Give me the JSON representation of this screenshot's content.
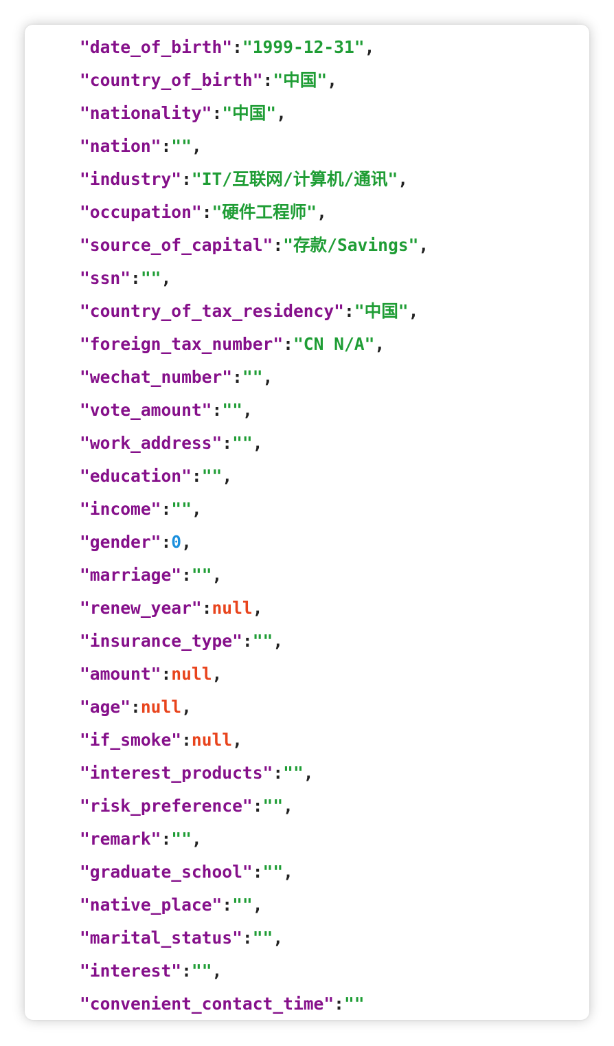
{
  "colors": {
    "key": "#85108a",
    "string": "#1f9d35",
    "number": "#1b90dd",
    "null": "#e8441d",
    "punctuation": "#222222"
  },
  "lines": [
    {
      "key": "\"date_of_birth\"",
      "value": "\"1999-12-31\"",
      "type": "string",
      "end": ","
    },
    {
      "key": "\"country_of_birth\"",
      "value": "\"中国\"",
      "type": "string",
      "end": ","
    },
    {
      "key": "\"nationality\"",
      "value": "\"中国\"",
      "type": "string",
      "end": ","
    },
    {
      "key": "\"nation\"",
      "value": "\"\"",
      "type": "string",
      "end": ","
    },
    {
      "key": "\"industry\"",
      "value": "\"IT/互联网/计算机/通讯\"",
      "type": "string",
      "end": ","
    },
    {
      "key": "\"occupation\"",
      "value": "\"硬件工程师\"",
      "type": "string",
      "end": ","
    },
    {
      "key": "\"source_of_capital\"",
      "value": "\"存款/Savings\"",
      "type": "string",
      "end": ","
    },
    {
      "key": "\"ssn\"",
      "value": "\"\"",
      "type": "string",
      "end": ","
    },
    {
      "key": "\"country_of_tax_residency\"",
      "value": "\"中国\"",
      "type": "string",
      "end": ","
    },
    {
      "key": "\"foreign_tax_number\"",
      "value": "\"CN N/A\"",
      "type": "string",
      "end": ","
    },
    {
      "key": "\"wechat_number\"",
      "value": "\"\"",
      "type": "string",
      "end": ","
    },
    {
      "key": "\"vote_amount\"",
      "value": "\"\"",
      "type": "string",
      "end": ","
    },
    {
      "key": "\"work_address\"",
      "value": "\"\"",
      "type": "string",
      "end": ","
    },
    {
      "key": "\"education\"",
      "value": "\"\"",
      "type": "string",
      "end": ","
    },
    {
      "key": "\"income\"",
      "value": "\"\"",
      "type": "string",
      "end": ","
    },
    {
      "key": "\"gender\"",
      "value": "0",
      "type": "number",
      "end": ","
    },
    {
      "key": "\"marriage\"",
      "value": "\"\"",
      "type": "string",
      "end": ","
    },
    {
      "key": "\"renew_year\"",
      "value": "null",
      "type": "null",
      "end": ","
    },
    {
      "key": "\"insurance_type\"",
      "value": "\"\"",
      "type": "string",
      "end": ","
    },
    {
      "key": "\"amount\"",
      "value": "null",
      "type": "null",
      "end": ","
    },
    {
      "key": "\"age\"",
      "value": "null",
      "type": "null",
      "end": ","
    },
    {
      "key": "\"if_smoke\"",
      "value": "null",
      "type": "null",
      "end": ","
    },
    {
      "key": "\"interest_products\"",
      "value": "\"\"",
      "type": "string",
      "end": ","
    },
    {
      "key": "\"risk_preference\"",
      "value": "\"\"",
      "type": "string",
      "end": ","
    },
    {
      "key": "\"remark\"",
      "value": "\"\"",
      "type": "string",
      "end": ","
    },
    {
      "key": "\"graduate_school\"",
      "value": "\"\"",
      "type": "string",
      "end": ","
    },
    {
      "key": "\"native_place\"",
      "value": "\"\"",
      "type": "string",
      "end": ","
    },
    {
      "key": "\"marital_status\"",
      "value": "\"\"",
      "type": "string",
      "end": ","
    },
    {
      "key": "\"interest\"",
      "value": "\"\"",
      "type": "string",
      "end": ","
    },
    {
      "key": "\"convenient_contact_time\"",
      "value": "\"\"",
      "type": "string",
      "end": ""
    }
  ]
}
